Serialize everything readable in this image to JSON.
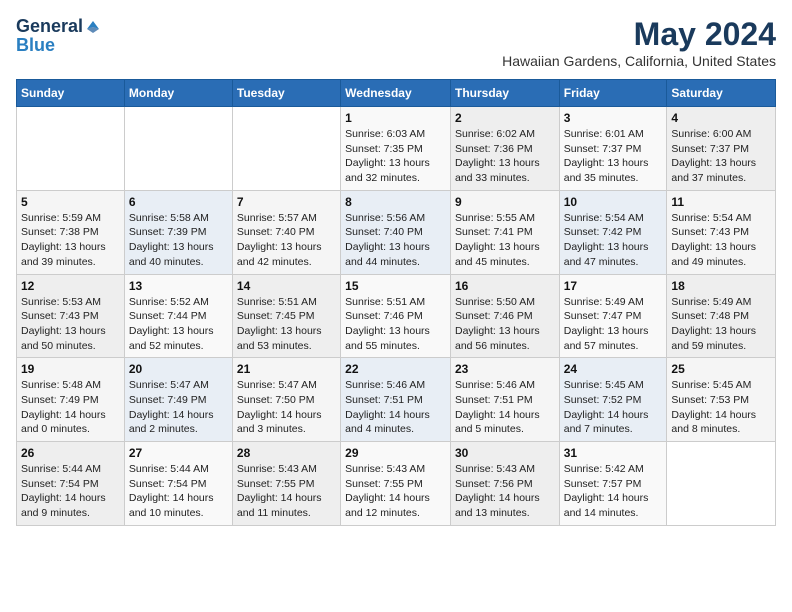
{
  "logo": {
    "general": "General",
    "blue": "Blue"
  },
  "title": "May 2024",
  "subtitle": "Hawaiian Gardens, California, United States",
  "days_of_week": [
    "Sunday",
    "Monday",
    "Tuesday",
    "Wednesday",
    "Thursday",
    "Friday",
    "Saturday"
  ],
  "weeks": [
    [
      {
        "day": "",
        "info": ""
      },
      {
        "day": "",
        "info": ""
      },
      {
        "day": "",
        "info": ""
      },
      {
        "day": "1",
        "info": "Sunrise: 6:03 AM\nSunset: 7:35 PM\nDaylight: 13 hours\nand 32 minutes."
      },
      {
        "day": "2",
        "info": "Sunrise: 6:02 AM\nSunset: 7:36 PM\nDaylight: 13 hours\nand 33 minutes."
      },
      {
        "day": "3",
        "info": "Sunrise: 6:01 AM\nSunset: 7:37 PM\nDaylight: 13 hours\nand 35 minutes."
      },
      {
        "day": "4",
        "info": "Sunrise: 6:00 AM\nSunset: 7:37 PM\nDaylight: 13 hours\nand 37 minutes."
      }
    ],
    [
      {
        "day": "5",
        "info": "Sunrise: 5:59 AM\nSunset: 7:38 PM\nDaylight: 13 hours\nand 39 minutes."
      },
      {
        "day": "6",
        "info": "Sunrise: 5:58 AM\nSunset: 7:39 PM\nDaylight: 13 hours\nand 40 minutes."
      },
      {
        "day": "7",
        "info": "Sunrise: 5:57 AM\nSunset: 7:40 PM\nDaylight: 13 hours\nand 42 minutes."
      },
      {
        "day": "8",
        "info": "Sunrise: 5:56 AM\nSunset: 7:40 PM\nDaylight: 13 hours\nand 44 minutes."
      },
      {
        "day": "9",
        "info": "Sunrise: 5:55 AM\nSunset: 7:41 PM\nDaylight: 13 hours\nand 45 minutes."
      },
      {
        "day": "10",
        "info": "Sunrise: 5:54 AM\nSunset: 7:42 PM\nDaylight: 13 hours\nand 47 minutes."
      },
      {
        "day": "11",
        "info": "Sunrise: 5:54 AM\nSunset: 7:43 PM\nDaylight: 13 hours\nand 49 minutes."
      }
    ],
    [
      {
        "day": "12",
        "info": "Sunrise: 5:53 AM\nSunset: 7:43 PM\nDaylight: 13 hours\nand 50 minutes."
      },
      {
        "day": "13",
        "info": "Sunrise: 5:52 AM\nSunset: 7:44 PM\nDaylight: 13 hours\nand 52 minutes."
      },
      {
        "day": "14",
        "info": "Sunrise: 5:51 AM\nSunset: 7:45 PM\nDaylight: 13 hours\nand 53 minutes."
      },
      {
        "day": "15",
        "info": "Sunrise: 5:51 AM\nSunset: 7:46 PM\nDaylight: 13 hours\nand 55 minutes."
      },
      {
        "day": "16",
        "info": "Sunrise: 5:50 AM\nSunset: 7:46 PM\nDaylight: 13 hours\nand 56 minutes."
      },
      {
        "day": "17",
        "info": "Sunrise: 5:49 AM\nSunset: 7:47 PM\nDaylight: 13 hours\nand 57 minutes."
      },
      {
        "day": "18",
        "info": "Sunrise: 5:49 AM\nSunset: 7:48 PM\nDaylight: 13 hours\nand 59 minutes."
      }
    ],
    [
      {
        "day": "19",
        "info": "Sunrise: 5:48 AM\nSunset: 7:49 PM\nDaylight: 14 hours\nand 0 minutes."
      },
      {
        "day": "20",
        "info": "Sunrise: 5:47 AM\nSunset: 7:49 PM\nDaylight: 14 hours\nand 2 minutes."
      },
      {
        "day": "21",
        "info": "Sunrise: 5:47 AM\nSunset: 7:50 PM\nDaylight: 14 hours\nand 3 minutes."
      },
      {
        "day": "22",
        "info": "Sunrise: 5:46 AM\nSunset: 7:51 PM\nDaylight: 14 hours\nand 4 minutes."
      },
      {
        "day": "23",
        "info": "Sunrise: 5:46 AM\nSunset: 7:51 PM\nDaylight: 14 hours\nand 5 minutes."
      },
      {
        "day": "24",
        "info": "Sunrise: 5:45 AM\nSunset: 7:52 PM\nDaylight: 14 hours\nand 7 minutes."
      },
      {
        "day": "25",
        "info": "Sunrise: 5:45 AM\nSunset: 7:53 PM\nDaylight: 14 hours\nand 8 minutes."
      }
    ],
    [
      {
        "day": "26",
        "info": "Sunrise: 5:44 AM\nSunset: 7:54 PM\nDaylight: 14 hours\nand 9 minutes."
      },
      {
        "day": "27",
        "info": "Sunrise: 5:44 AM\nSunset: 7:54 PM\nDaylight: 14 hours\nand 10 minutes."
      },
      {
        "day": "28",
        "info": "Sunrise: 5:43 AM\nSunset: 7:55 PM\nDaylight: 14 hours\nand 11 minutes."
      },
      {
        "day": "29",
        "info": "Sunrise: 5:43 AM\nSunset: 7:55 PM\nDaylight: 14 hours\nand 12 minutes."
      },
      {
        "day": "30",
        "info": "Sunrise: 5:43 AM\nSunset: 7:56 PM\nDaylight: 14 hours\nand 13 minutes."
      },
      {
        "day": "31",
        "info": "Sunrise: 5:42 AM\nSunset: 7:57 PM\nDaylight: 14 hours\nand 14 minutes."
      },
      {
        "day": "",
        "info": ""
      }
    ]
  ]
}
